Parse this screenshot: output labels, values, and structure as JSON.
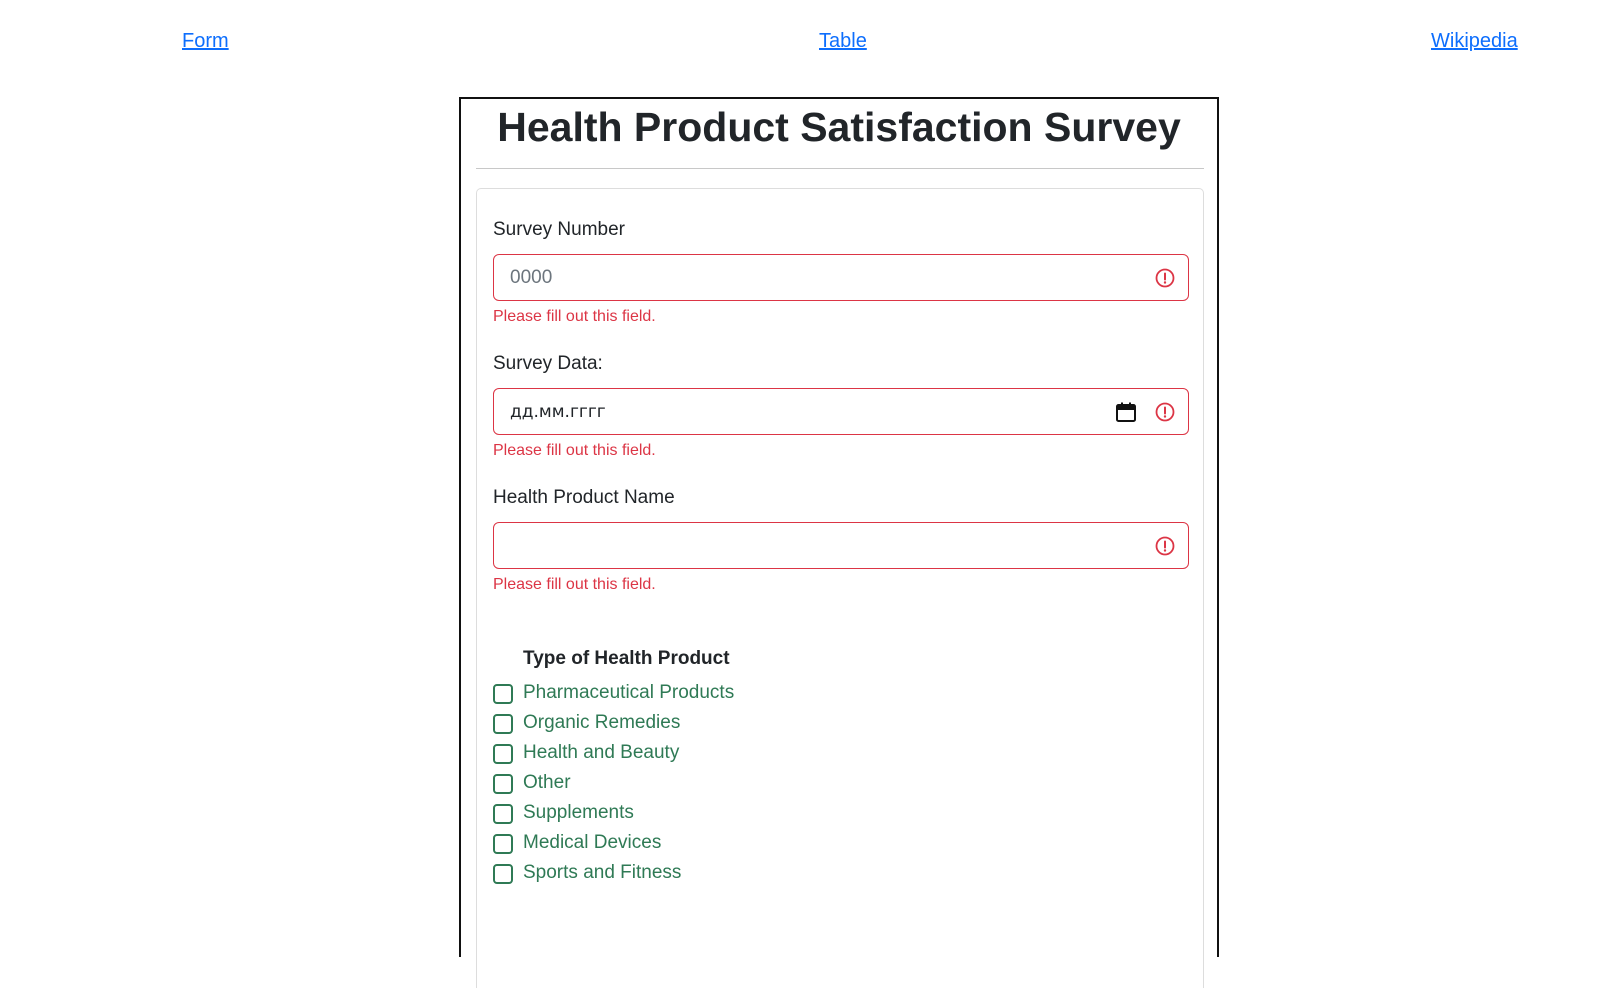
{
  "nav": {
    "form": "Form",
    "table": "Table",
    "wikipedia": "Wikipedia"
  },
  "page_title": "Health Product Satisfaction Survey",
  "fields": {
    "survey_number": {
      "label": "Survey Number",
      "placeholder": "0000",
      "error": "Please fill out this field."
    },
    "survey_date": {
      "label": "Survey Data:",
      "value": "дд.мм.гггг",
      "error": "Please fill out this field."
    },
    "product_name": {
      "label": "Health Product Name",
      "value": "",
      "error": "Please fill out this field."
    }
  },
  "product_type": {
    "legend": "Type of Health Product",
    "options": [
      "Pharmaceutical Products",
      "Organic Remedies",
      "Health and Beauty",
      "Other",
      "Supplements",
      "Medical Devices",
      "Sports and Fitness"
    ]
  },
  "colors": {
    "link": "#0d6efd",
    "invalid": "#dc3545",
    "checkbox_accent": "#2f7a55"
  }
}
